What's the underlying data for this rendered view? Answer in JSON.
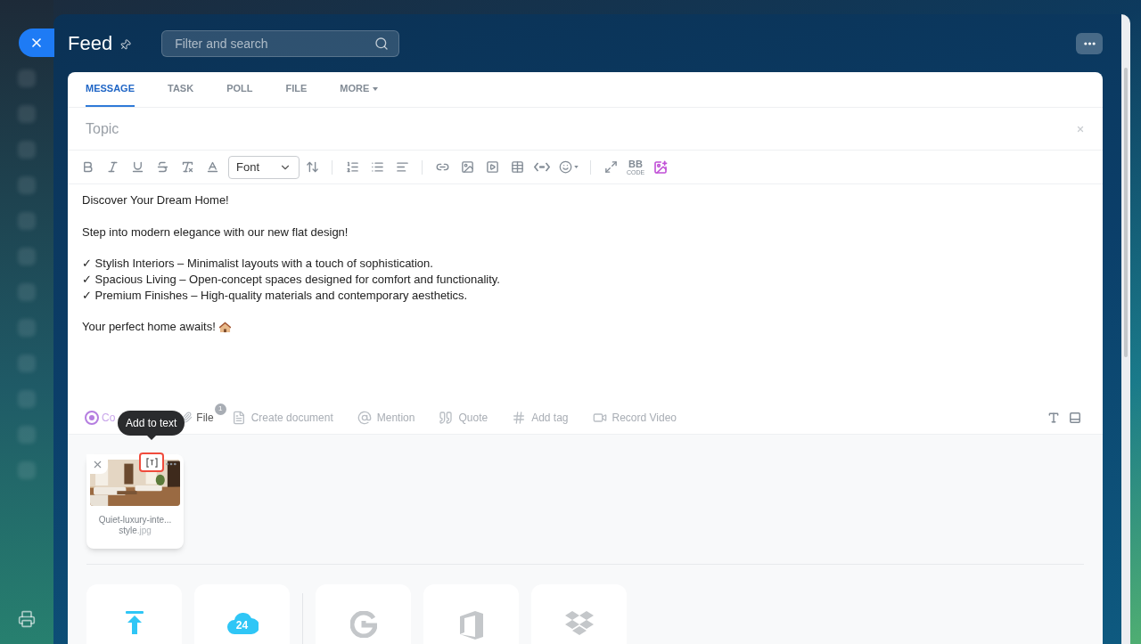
{
  "header": {
    "title": "Feed",
    "search": {
      "placeholder": "Filter and search"
    }
  },
  "tabs": [
    {
      "label": "MESSAGE",
      "selected": true,
      "menu": false
    },
    {
      "label": "TASK",
      "selected": false,
      "menu": false
    },
    {
      "label": "POLL",
      "selected": false,
      "menu": false
    },
    {
      "label": "FILE",
      "selected": false,
      "menu": false
    },
    {
      "label": "MORE",
      "selected": false,
      "menu": true
    }
  ],
  "topic": {
    "placeholder": "Topic"
  },
  "toolbar": {
    "font": "Font",
    "bbcode": "BB",
    "bbcode_sub": "CODE"
  },
  "message": [
    [
      "Discover Your Dream Home!"
    ],
    [
      "Step into modern elegance with our new flat design!"
    ],
    [
      "✓ Stylish Interiors – Minimalist layouts with a touch of sophistication.",
      "✓ Spacious Living – Open-concept spaces designed for comfort and functionality.",
      "✓ Premium Finishes – High-quality materials and contemporary aesthetics."
    ],
    [
      "Your perfect home awaits!"
    ]
  ],
  "actions": [
    {
      "kind": "copilot",
      "label": "Co"
    },
    {
      "kind": "file",
      "label": "File",
      "badge": "1"
    },
    {
      "kind": "document",
      "label": "Create document"
    },
    {
      "kind": "mention",
      "label": "Mention"
    },
    {
      "kind": "quote",
      "label": "Quote"
    },
    {
      "kind": "tag",
      "label": "Add tag"
    },
    {
      "kind": "video",
      "label": "Record Video"
    }
  ],
  "tooltip": "Add to text",
  "attachment": {
    "kind": "picture",
    "name_line1": "Quiet-luxury-inte...",
    "name_base": "style",
    "name_ext": ".jpg"
  },
  "storage_logo_text": "24"
}
